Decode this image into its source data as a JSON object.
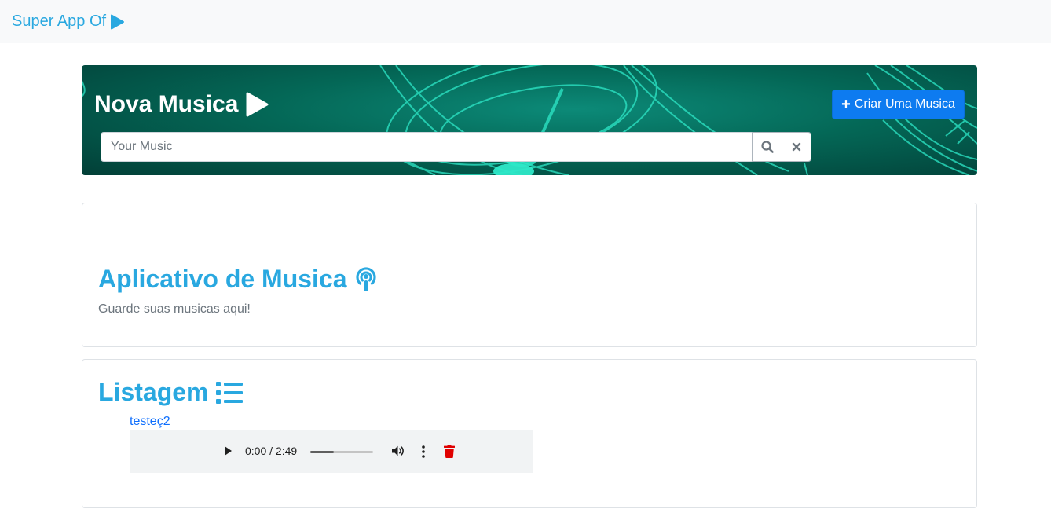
{
  "navbar": {
    "brand": "Super App Of"
  },
  "hero": {
    "title": "Nova Musica",
    "create_button": "Criar Uma Musica",
    "search": {
      "placeholder": "Your Music",
      "value": ""
    },
    "accent_color": "#0d7bf0"
  },
  "intro": {
    "heading": "Aplicativo de Musica",
    "subtitle": "Guarde suas musicas aqui!"
  },
  "listing": {
    "heading": "Listagem",
    "tracks": [
      {
        "title": "testeç2",
        "time": "0:00 / 2:49",
        "progress": 0.37
      }
    ]
  },
  "colors": {
    "heading": "#29a8e0",
    "delete": "#e00000"
  }
}
